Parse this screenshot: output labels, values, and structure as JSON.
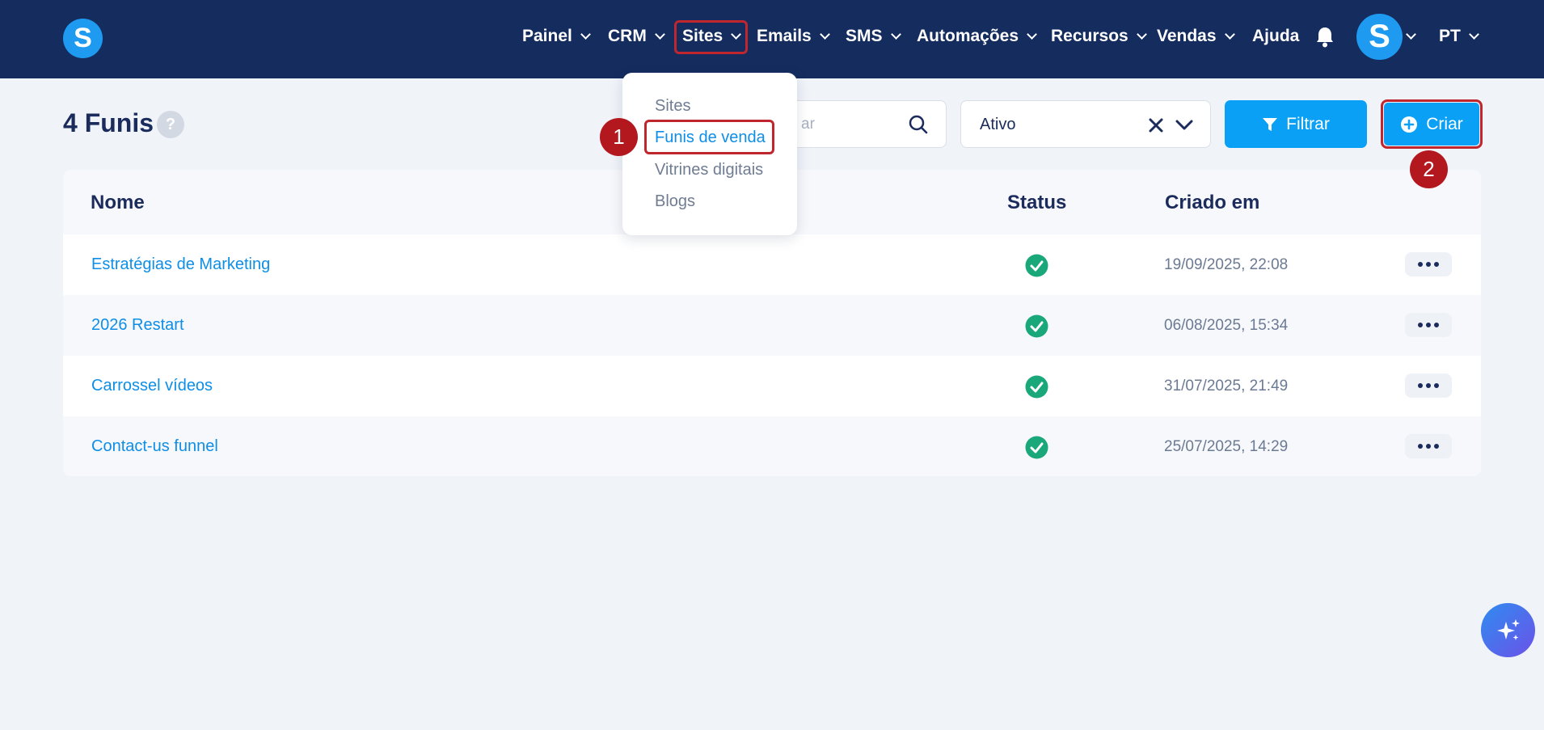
{
  "nav": {
    "items": [
      {
        "label": "Painel"
      },
      {
        "label": "CRM"
      },
      {
        "label": "Sites"
      },
      {
        "label": "Emails"
      },
      {
        "label": "SMS"
      },
      {
        "label": "Automações"
      },
      {
        "label": "Recursos"
      },
      {
        "label": "Vendas"
      },
      {
        "label": "Ajuda"
      }
    ],
    "avatar_letter": "S",
    "logo_letter": "S",
    "language": "PT"
  },
  "page": {
    "title": "4 Funis",
    "help": "?"
  },
  "toolbar": {
    "search_placeholder": "ar",
    "status_value": "Ativo",
    "filter_label": "Filtrar",
    "create_label": "Criar"
  },
  "dropdown": {
    "items": [
      {
        "label": "Sites"
      },
      {
        "label": "Funis de venda"
      },
      {
        "label": "Vitrines digitais"
      },
      {
        "label": "Blogs"
      }
    ]
  },
  "badges": [
    "1",
    "2"
  ],
  "table": {
    "headers": {
      "name": "Nome",
      "status": "Status",
      "created": "Criado em"
    },
    "rows": [
      {
        "name": "Estratégias de Marketing",
        "created": "19/09/2025, 22:08"
      },
      {
        "name": "2026 Restart",
        "created": "06/08/2025, 15:34"
      },
      {
        "name": "Carrossel vídeos",
        "created": "31/07/2025, 21:49"
      },
      {
        "name": "Contact-us funnel",
        "created": "25/07/2025, 14:29"
      }
    ]
  },
  "colors": {
    "topbar": "#152c5f",
    "accent": "#0aa0f5",
    "highlight": "#c0262d",
    "success": "#1aa77a"
  }
}
